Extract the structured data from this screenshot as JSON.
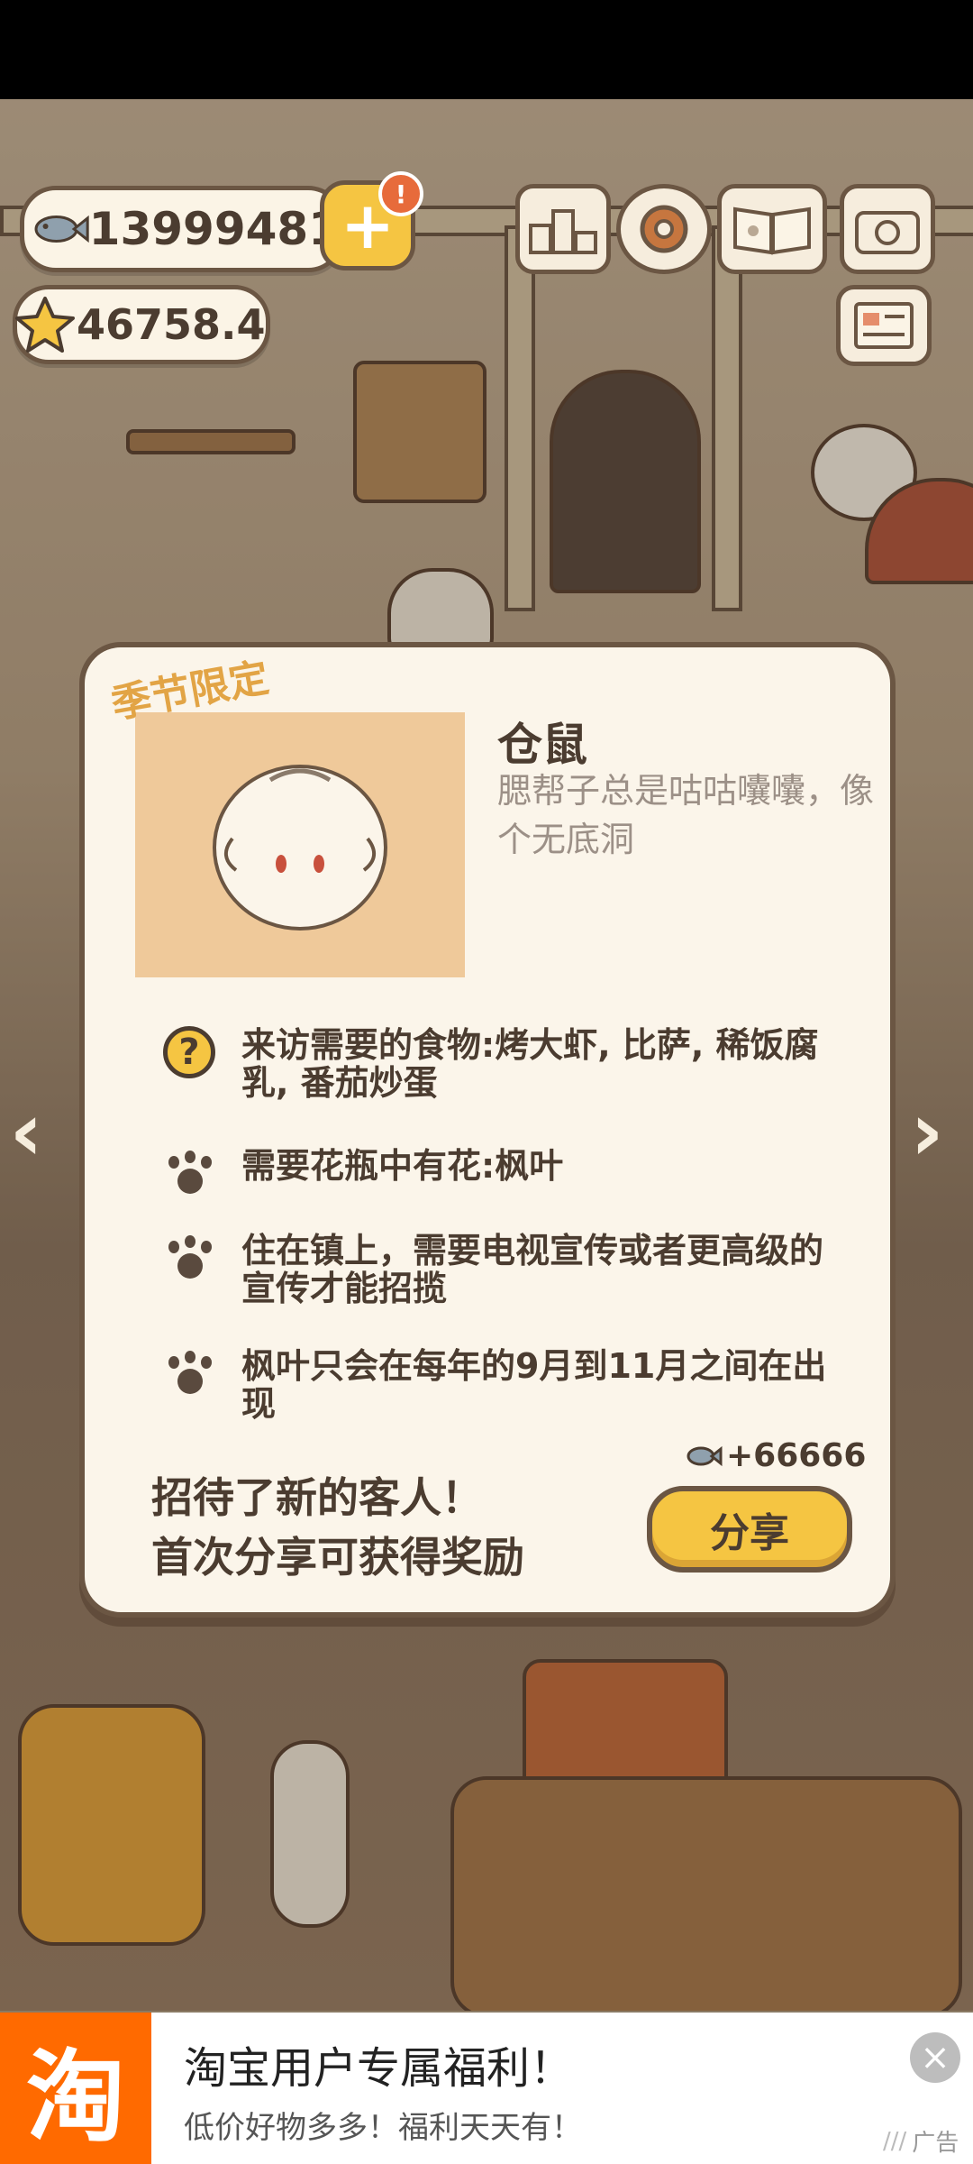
{
  "hud": {
    "fish_coins": "13999481",
    "stars": "46758.4",
    "plus_label": "+",
    "alert_label": "!",
    "icons": [
      "fish-icon",
      "star-icon",
      "leaderboard-icon",
      "settings-gear-icon",
      "paw-book-icon",
      "camera-icon",
      "newspaper-icon"
    ]
  },
  "dialog": {
    "badge": "季节限定",
    "guest_name": "仓鼠",
    "guest_desc": "腮帮子总是咕咕囔囔，像个无底洞",
    "requirements": [
      {
        "icon": "question-icon",
        "text": "来访需要的食物:烤大虾, 比萨, 稀饭腐乳, 番茄炒蛋"
      },
      {
        "icon": "paw-icon",
        "text": "需要花瓶中有花:枫叶"
      },
      {
        "icon": "paw-icon",
        "text": "住在镇上，需要电视宣传或者更高级的宣传才能招揽"
      },
      {
        "icon": "paw-icon",
        "text": "枫叶只会在每年的9月到11月之间在出现"
      }
    ],
    "reward": "+66666",
    "share_message_line1": "招待了新的客人！",
    "share_message_line2": "首次分享可获得奖励",
    "share_button": "分享"
  },
  "ad": {
    "logo_char": "淘",
    "title": "淘宝用户专属福利！",
    "subtitle": "低价好物多多！福利天天有！",
    "tag": "广告",
    "close": "×"
  },
  "colors": {
    "accent_yellow": "#f5c542",
    "ink": "#4b3c30",
    "panel": "#fbf5ea",
    "taobao_orange": "#ff6a00"
  }
}
